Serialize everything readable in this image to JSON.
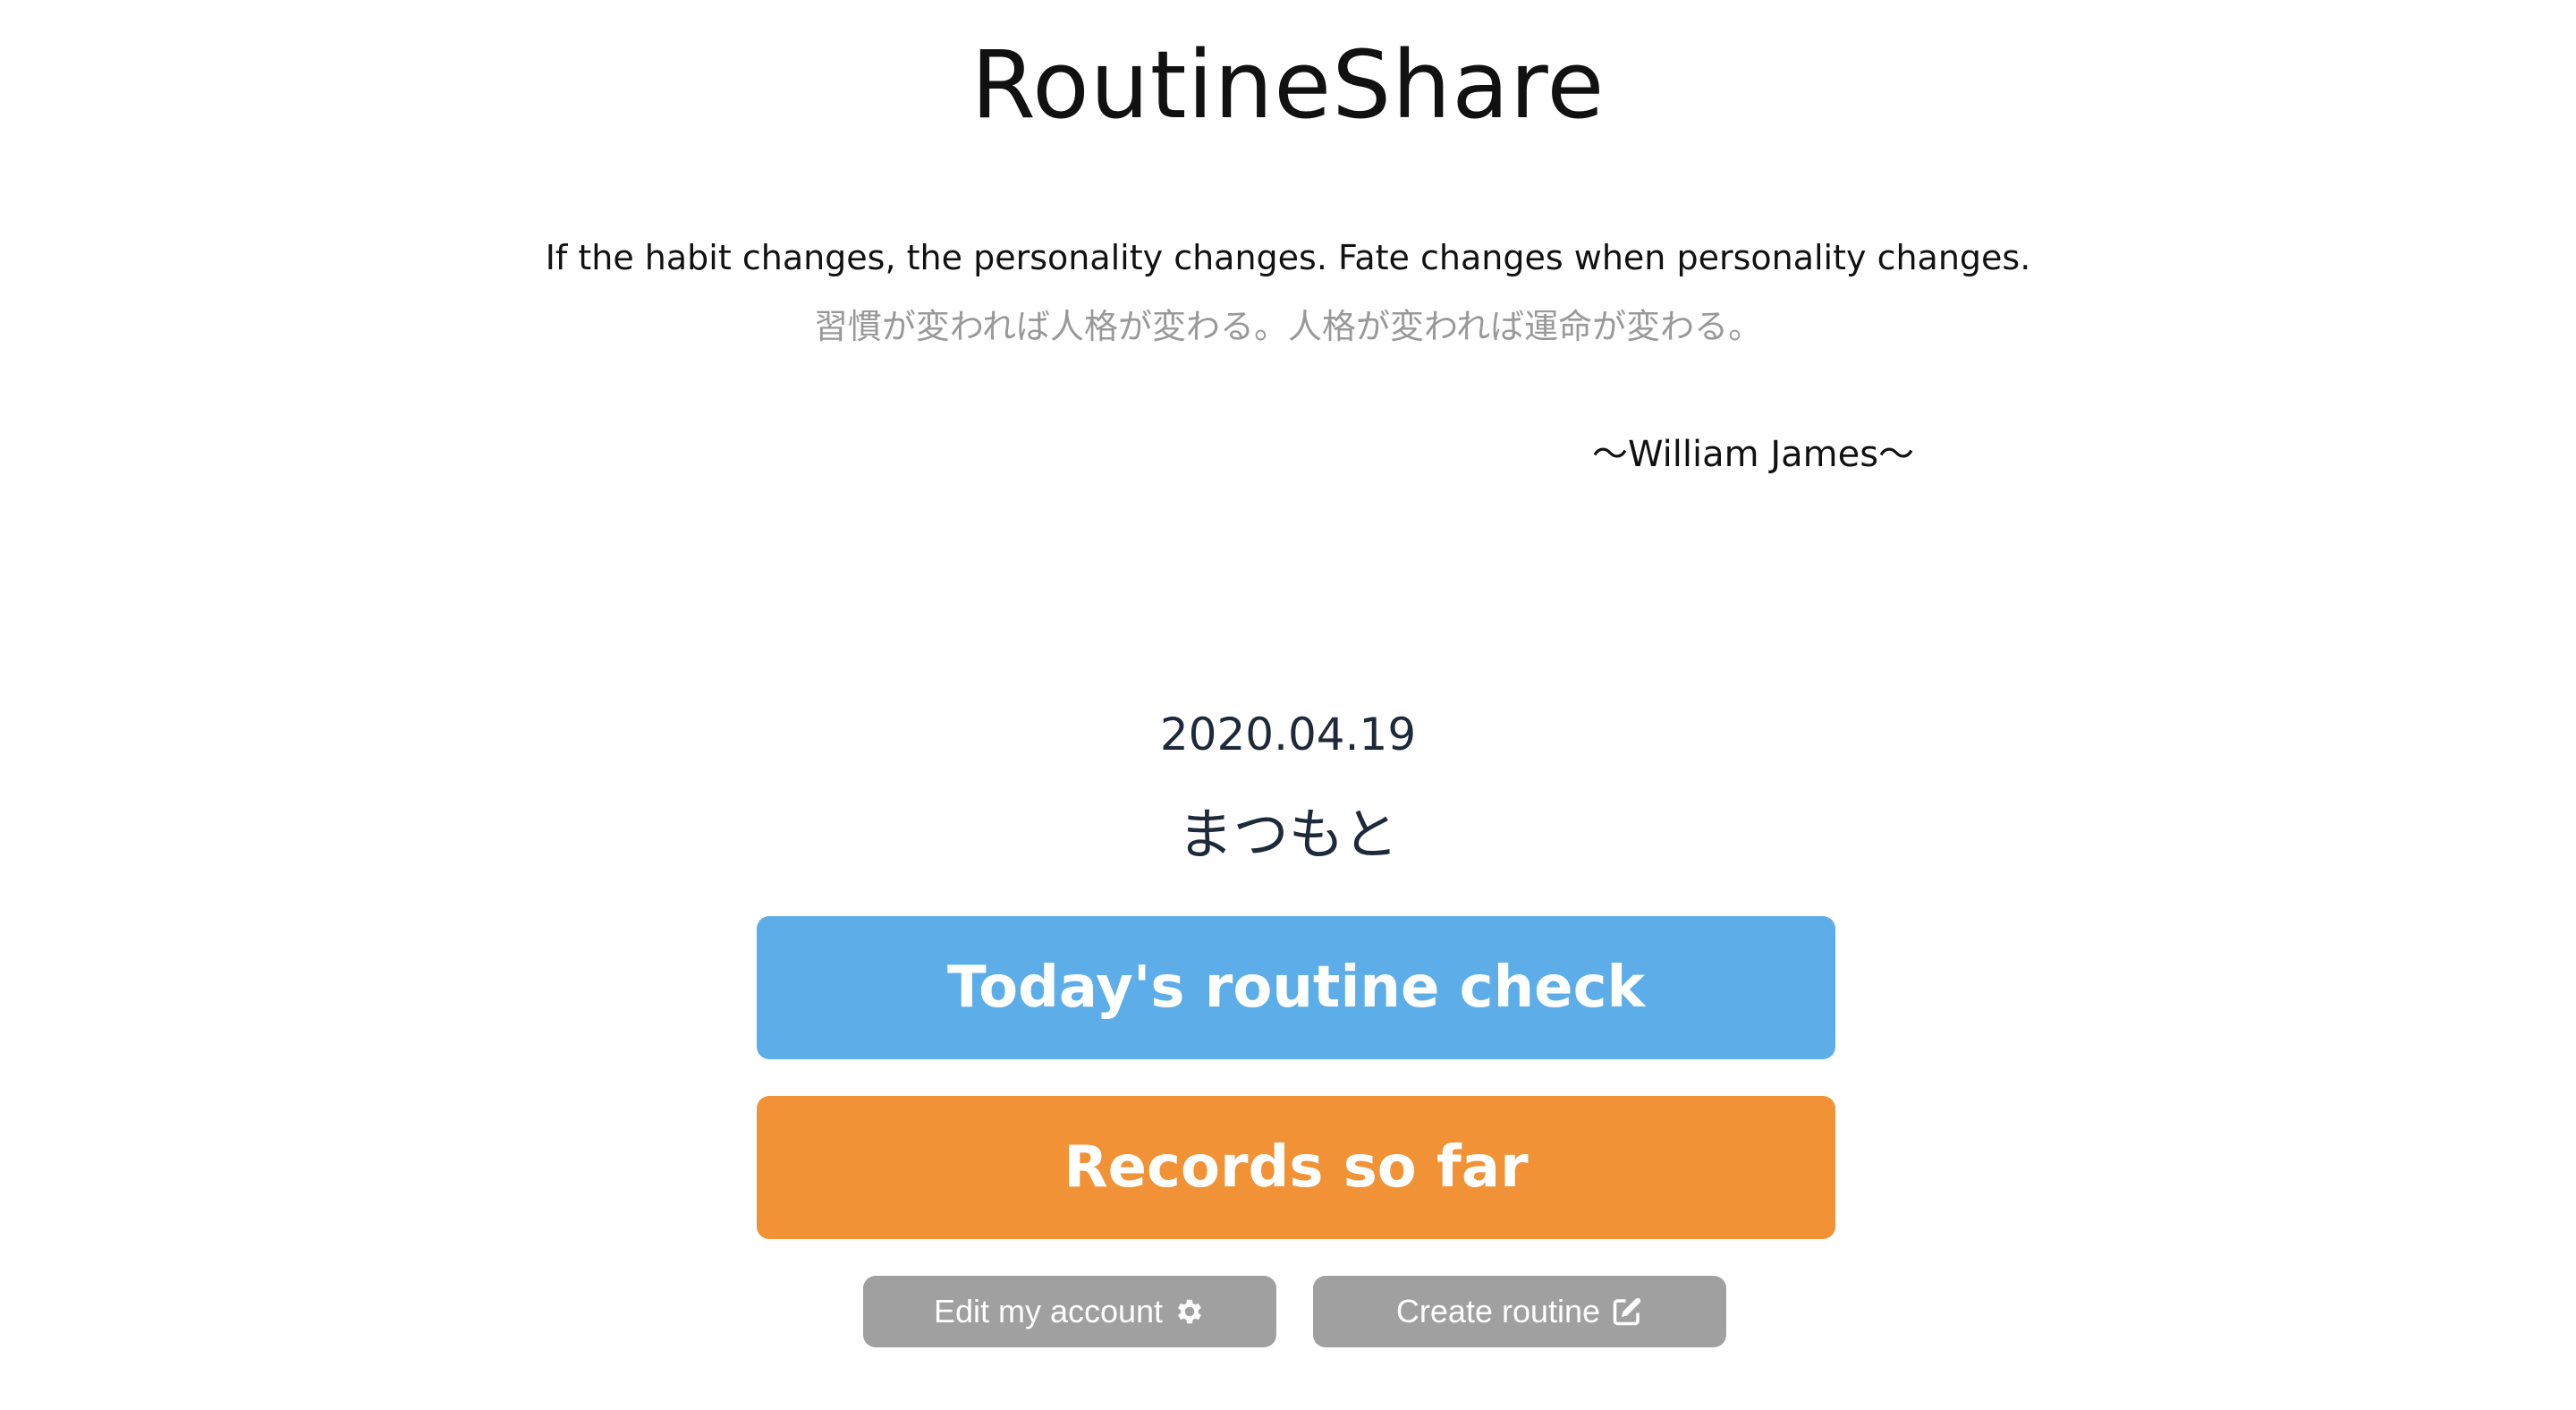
{
  "header": {
    "app_title": "RoutineShare"
  },
  "quote": {
    "english": "If the habit changes, the personality changes. Fate changes when personality changes.",
    "japanese": "習慣が変われば人格が変わる。人格が変われば運命が変わる。",
    "author": "〜William James〜"
  },
  "main": {
    "date": "2020.04.19",
    "user_name": "まつもと"
  },
  "actions": {
    "routine_check_label": "Today's routine check",
    "records_label": "Records so far",
    "edit_account_label": "Edit my account",
    "edit_account_icon": "gear-icon",
    "create_routine_label": "Create routine",
    "create_routine_icon": "edit-icon"
  },
  "colors": {
    "routine_button": "#5daee8",
    "records_button": "#f09235",
    "secondary_button": "#a0a0a0",
    "quote_japanese": "#999999"
  }
}
